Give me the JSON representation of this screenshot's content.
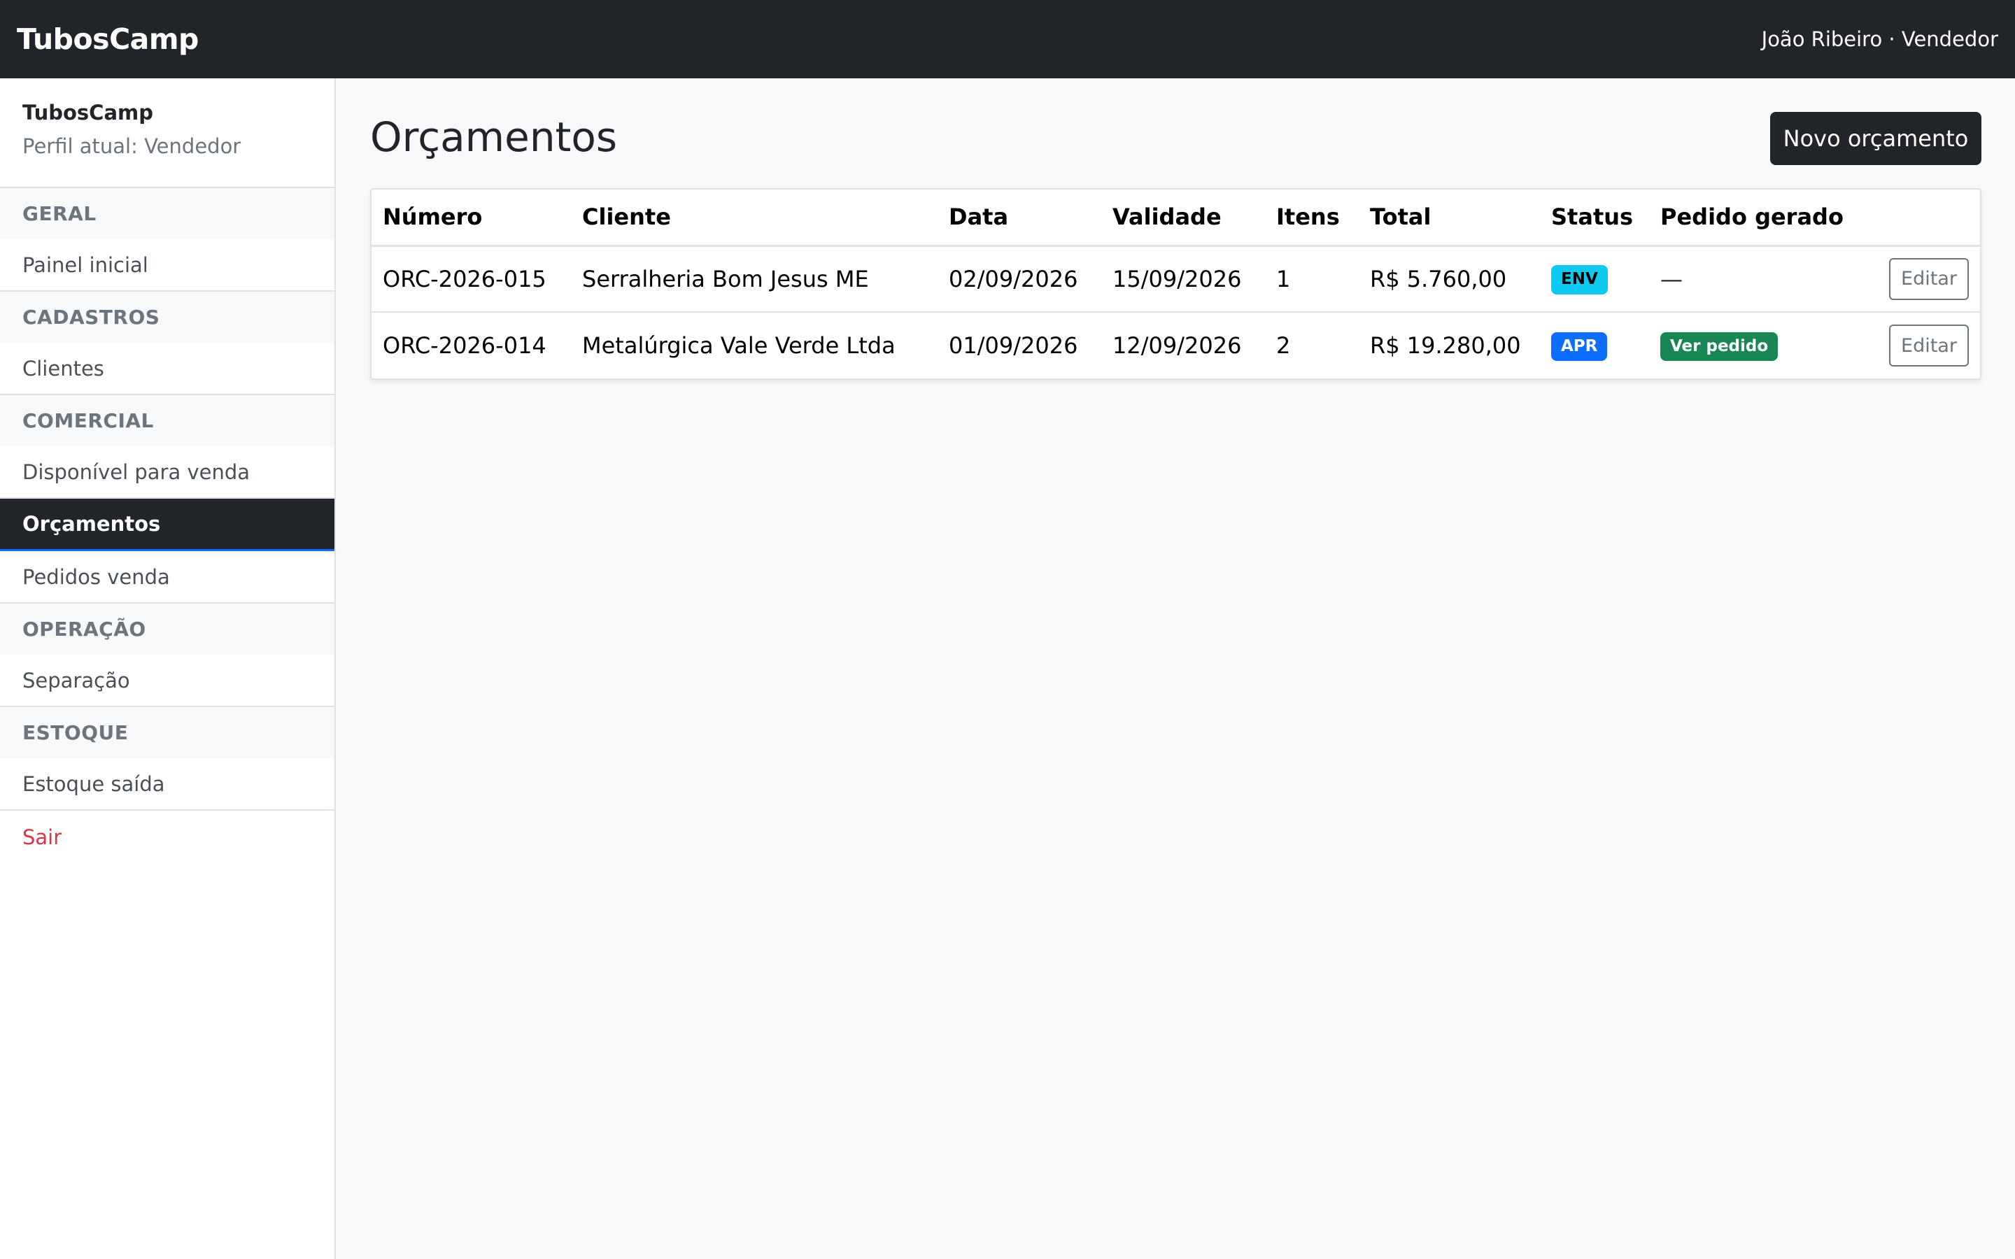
{
  "topbar": {
    "brand": "TubosCamp",
    "user": "João Ribeiro · Vendedor"
  },
  "sidebar": {
    "brand": "TubosCamp",
    "role": "Perfil atual: Vendedor",
    "sections": {
      "geral": "GERAL",
      "cadastros": "CADASTROS",
      "comercial": "COMERCIAL",
      "operacao": "OPERAÇÃO",
      "estoque": "ESTOQUE"
    },
    "items": {
      "painel": "Painel inicial",
      "clientes": "Clientes",
      "disponivel": "Disponível para venda",
      "orcamentos": "Orçamentos",
      "pedidos": "Pedidos venda",
      "separacao": "Separação",
      "estoque_saida": "Estoque saída",
      "sair": "Sair"
    },
    "active": "orcamentos"
  },
  "main": {
    "title": "Orçamentos",
    "new_button": "Novo orçamento",
    "columns": [
      "Número",
      "Cliente",
      "Data",
      "Validade",
      "Itens",
      "Total",
      "Status",
      "Pedido gerado"
    ],
    "rows": [
      {
        "numero": "ORC-2026-015",
        "cliente": "Serralheria Bom Jesus ME",
        "data": "02/09/2026",
        "validade": "15/09/2026",
        "itens": "1",
        "total": "R$ 5.760,00",
        "status": "ENV",
        "pedido": "—",
        "action": "Editar"
      },
      {
        "numero": "ORC-2026-014",
        "cliente": "Metalúrgica Vale Verde Ltda",
        "data": "01/09/2026",
        "validade": "12/09/2026",
        "itens": "2",
        "total": "R$ 19.280,00",
        "status": "APR",
        "pedido": "Ver pedido",
        "action": "Editar"
      }
    ]
  },
  "colors": {
    "dark": "#212529",
    "info": "#0dcaf0",
    "primary": "#0d6efd",
    "success": "#198754",
    "danger": "#dc3545"
  }
}
